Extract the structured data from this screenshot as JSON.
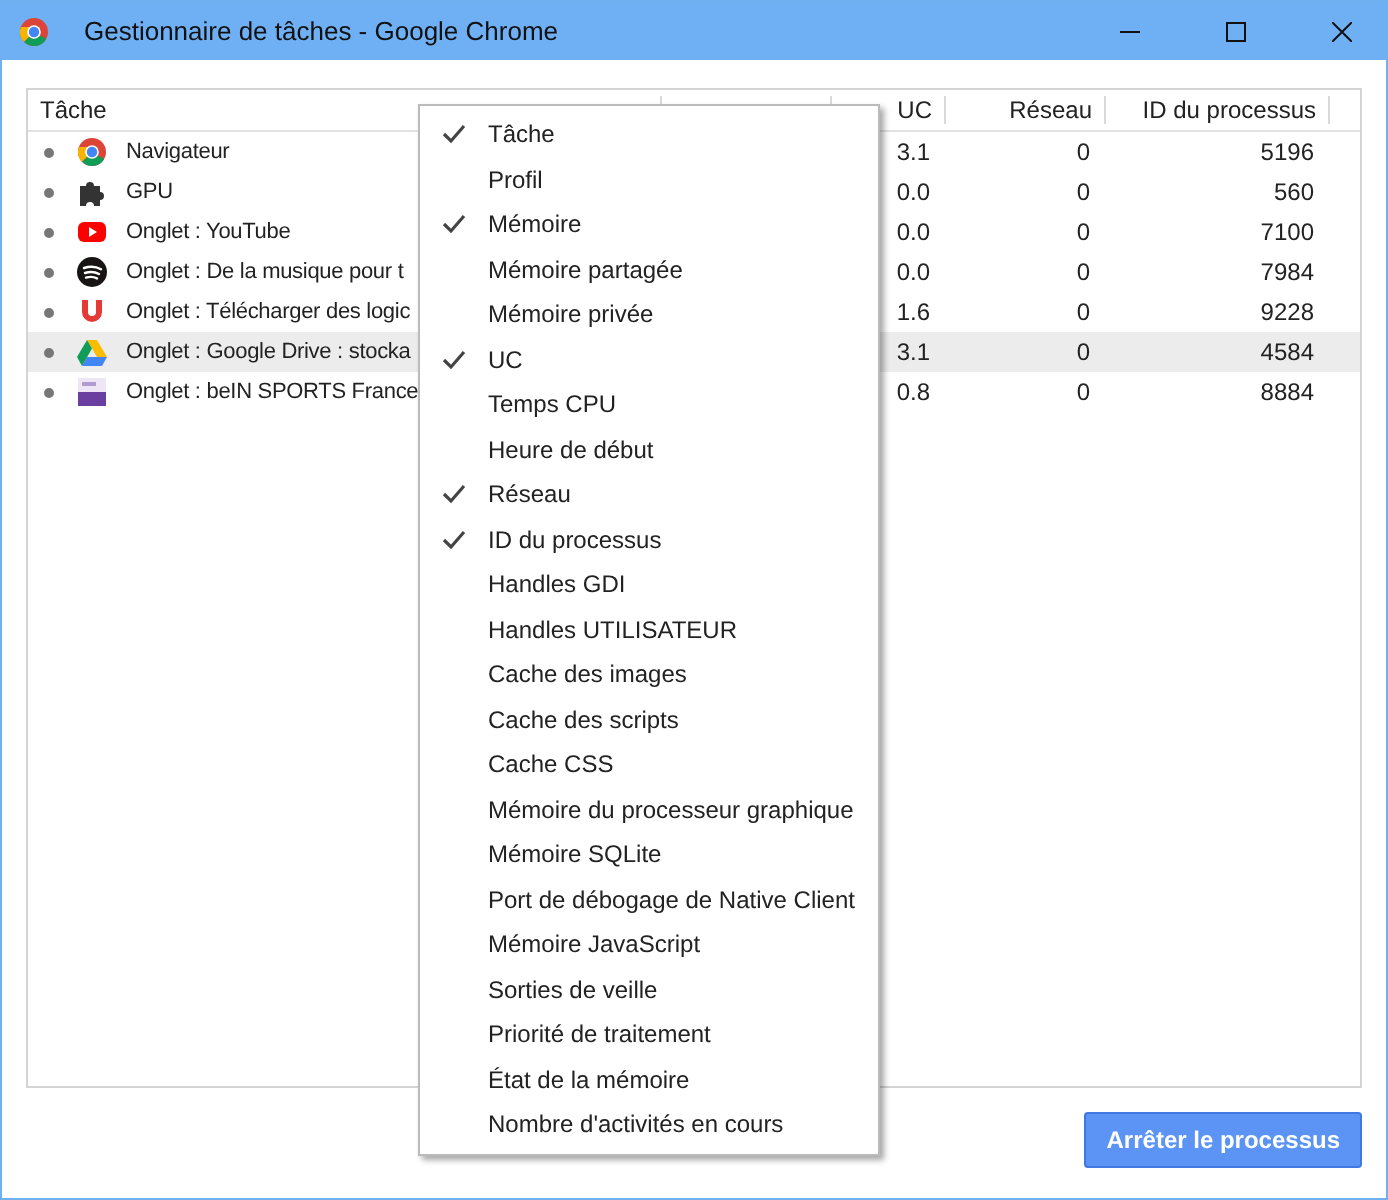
{
  "window": {
    "title": "Gestionnaire de tâches - Google Chrome"
  },
  "table": {
    "columns": [
      "Tâche",
      "",
      "UC",
      "Réseau",
      "ID du processus"
    ],
    "rows": [
      {
        "task": "Navigateur",
        "cpu": "3.1",
        "network": "0",
        "pid": "5196",
        "selected": false
      },
      {
        "task": "GPU",
        "cpu": "0.0",
        "network": "0",
        "pid": "560",
        "selected": false
      },
      {
        "task": "Onglet : YouTube",
        "cpu": "0.0",
        "network": "0",
        "pid": "7100",
        "selected": false
      },
      {
        "task": "Onglet : De la musique pour t",
        "cpu": "0.0",
        "network": "0",
        "pid": "7984",
        "selected": false
      },
      {
        "task": "Onglet : Télécharger des logic",
        "cpu": "1.6",
        "network": "0",
        "pid": "9228",
        "selected": false
      },
      {
        "task": "Onglet : Google Drive : stocka",
        "cpu": "3.1",
        "network": "0",
        "pid": "4584",
        "selected": true
      },
      {
        "task": "Onglet : beIN SPORTS France",
        "cpu": "0.8",
        "network": "0",
        "pid": "8884",
        "selected": false
      }
    ]
  },
  "menu": [
    {
      "label": "Tâche",
      "checked": true
    },
    {
      "label": "Profil",
      "checked": false
    },
    {
      "label": "Mémoire",
      "checked": true
    },
    {
      "label": "Mémoire partagée",
      "checked": false
    },
    {
      "label": "Mémoire privée",
      "checked": false
    },
    {
      "label": "UC",
      "checked": true
    },
    {
      "label": "Temps CPU",
      "checked": false
    },
    {
      "label": "Heure de début",
      "checked": false
    },
    {
      "label": "Réseau",
      "checked": true
    },
    {
      "label": "ID du processus",
      "checked": true
    },
    {
      "label": "Handles GDI",
      "checked": false
    },
    {
      "label": "Handles UTILISATEUR",
      "checked": false
    },
    {
      "label": "Cache des images",
      "checked": false
    },
    {
      "label": "Cache des scripts",
      "checked": false
    },
    {
      "label": "Cache CSS",
      "checked": false
    },
    {
      "label": "Mémoire du processeur graphique",
      "checked": false
    },
    {
      "label": "Mémoire SQLite",
      "checked": false
    },
    {
      "label": "Port de débogage de Native Client",
      "checked": false
    },
    {
      "label": "Mémoire JavaScript",
      "checked": false
    },
    {
      "label": "Sorties de veille",
      "checked": false
    },
    {
      "label": "Priorité de traitement",
      "checked": false
    },
    {
      "label": "État de la mémoire",
      "checked": false
    },
    {
      "label": "Nombre d'activités en cours",
      "checked": false
    }
  ],
  "end_button": "Arrêter le processus"
}
